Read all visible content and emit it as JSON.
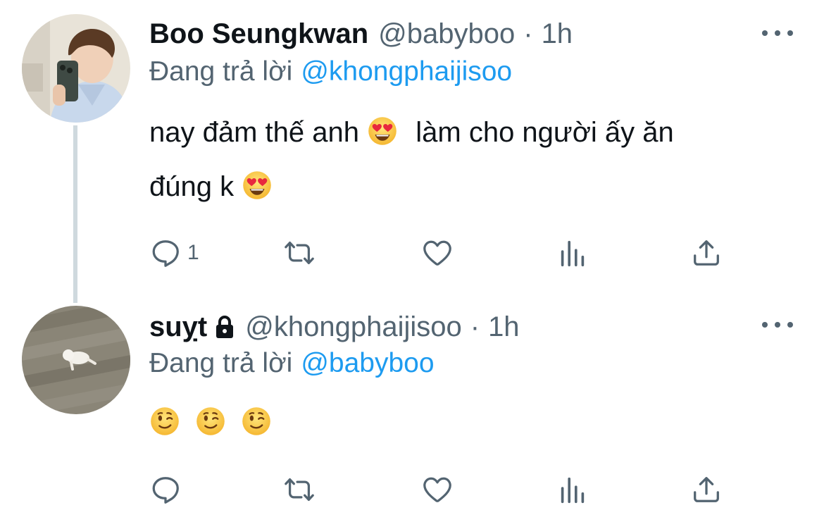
{
  "tweets": [
    {
      "author_name": "Boo Seungkwan",
      "author_handle": "@babyboo",
      "separator": "·",
      "time": "1h",
      "replying_prefix": "Đang trả lời",
      "replying_to": "@khongphaijisoo",
      "text_1": "nay đảm thế anh",
      "emoji_1": "heart-eyes-emoji",
      "text_2": "làm cho người ấy ăn",
      "text_3": "đúng k",
      "emoji_2": "heart-eyes-emoji",
      "reply_count": "1",
      "locked": false
    },
    {
      "author_name": "suỵt",
      "author_handle": "@khongphaijisoo",
      "separator": "·",
      "time": "1h",
      "replying_prefix": "Đang trả lời",
      "replying_to": "@babyboo",
      "emojis": [
        "winking-face-emoji",
        "winking-face-emoji",
        "winking-face-emoji"
      ],
      "reply_count": "",
      "locked": true
    }
  ],
  "icons": {
    "reply": "reply-icon",
    "retweet": "retweet-icon",
    "like": "heart-icon",
    "stats": "analytics-icon",
    "share": "share-icon",
    "more": "more-icon",
    "lock": "lock-icon"
  },
  "colors": {
    "text": "#0f1419",
    "secondary": "#536471",
    "link": "#1d9bf0",
    "thread_line": "#cfd9de"
  }
}
